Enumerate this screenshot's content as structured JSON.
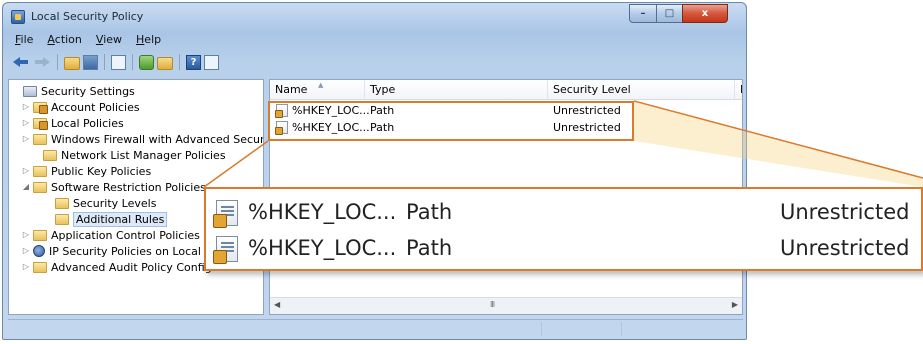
{
  "window": {
    "title": "Local Security Policy",
    "caption_buttons": {
      "minimize": "–",
      "maximize": "□",
      "close": "x"
    }
  },
  "menubar": {
    "items": [
      {
        "key": "F",
        "rest": "ile"
      },
      {
        "key": "A",
        "rest": "ction"
      },
      {
        "key": "V",
        "rest": "iew"
      },
      {
        "key": "H",
        "rest": "elp"
      }
    ]
  },
  "toolbar": {
    "icons": [
      "back-arrow-icon",
      "forward-arrow-icon",
      "up-folder-icon",
      "show-hide-tree-icon",
      "properties-icon",
      "refresh-icon",
      "export-list-icon",
      "help-icon",
      "show-action-pane-icon"
    ]
  },
  "tree": {
    "items": [
      {
        "label": "Security Settings",
        "expander": "",
        "icon": "settings"
      },
      {
        "label": "Account Policies",
        "expander": "▷",
        "icon": "policy"
      },
      {
        "label": "Local Policies",
        "expander": "▷",
        "icon": "policy"
      },
      {
        "label": "Windows Firewall with Advanced Security",
        "expander": "▷",
        "icon": "folder"
      },
      {
        "label": "Network List Manager Policies",
        "expander": "",
        "icon": "folder"
      },
      {
        "label": "Public Key Policies",
        "expander": "▷",
        "icon": "folder"
      },
      {
        "label": "Software Restriction Policies",
        "expander": "◢",
        "icon": "folder"
      },
      {
        "label": "Security Levels",
        "expander": "",
        "icon": "folder"
      },
      {
        "label": "Additional Rules",
        "expander": "",
        "icon": "folder",
        "selected": true
      },
      {
        "label": "Application Control Policies",
        "expander": "▷",
        "icon": "folder"
      },
      {
        "label": "IP Security Policies on Local Co",
        "expander": "▷",
        "icon": "ipsec"
      },
      {
        "label": "Advanced Audit Policy Configuration",
        "expander": "▷",
        "icon": "folder"
      }
    ]
  },
  "list": {
    "columns": [
      "Name",
      "Type",
      "Security Level",
      "D"
    ],
    "rows": [
      {
        "name": "%HKEY_LOC...",
        "type": "Path",
        "level": "Unrestricted"
      },
      {
        "name": "%HKEY_LOC...",
        "type": "Path",
        "level": "Unrestricted"
      }
    ],
    "scroll_grip": "III"
  },
  "callout": {
    "rows": [
      {
        "name": "%HKEY_LOC...",
        "type": "Path",
        "level": "Unrestricted"
      },
      {
        "name": "%HKEY_LOC...",
        "type": "Path",
        "level": "Unrestricted"
      }
    ]
  },
  "colors": {
    "accent": "#d97a2d",
    "window_frame": "#a9c5e6",
    "close_button": "#c3371b"
  }
}
